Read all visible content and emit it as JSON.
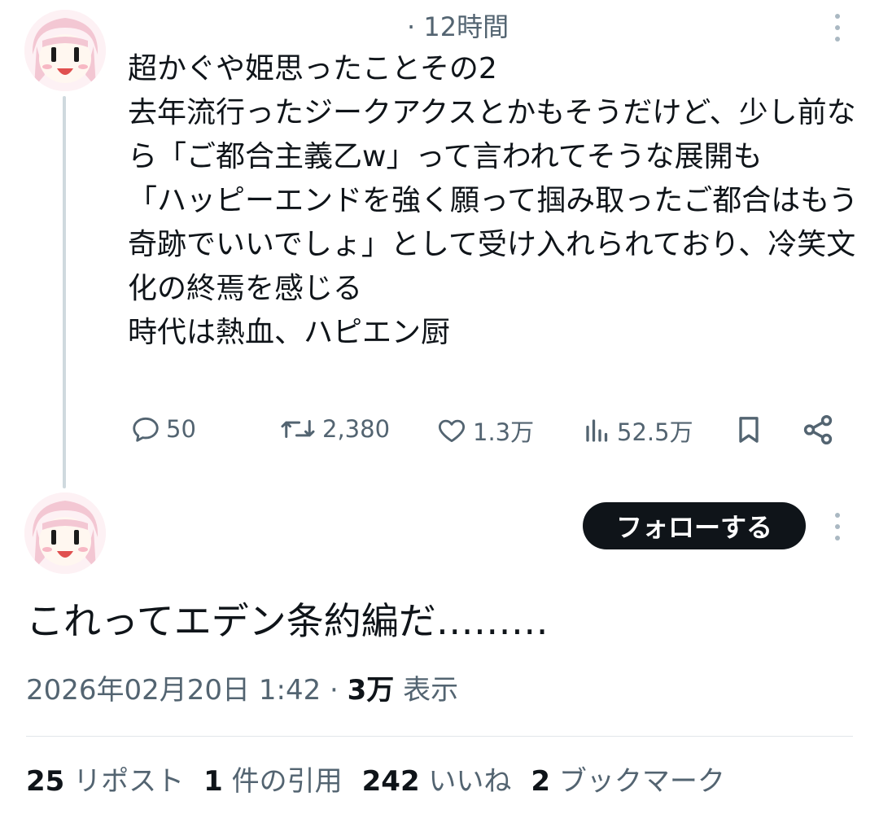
{
  "tweet": {
    "time": "· 12時間",
    "text": "超かぐや姫思ったことその2\n去年流行ったジークアクスとかもそうだけど、少し前なら「ご都合主義乙w」って言われてそうな展開も\n「ハッピーエンドを強く願って掴み取ったご都合はもう奇跡でいいでしょ」として受け入れられており、冷笑文化の終焉を感じる\n時代は熱血、ハピエン厨",
    "actions": {
      "replies": "50",
      "retweets": "2,380",
      "likes": "1.3万",
      "views": "52.5万"
    }
  },
  "reply": {
    "follow_label": "フォローする",
    "text": "これってエデン条約編だ………",
    "timestamp": "2026年02月20日 1:42 · ",
    "views_count": "3万",
    "views_label": " 表示"
  },
  "stats": [
    {
      "count": "25",
      "label": "リポスト"
    },
    {
      "count": "1",
      "label": "件の引用"
    },
    {
      "count": "242",
      "label": "いいね"
    },
    {
      "count": "2",
      "label": "ブックマーク"
    }
  ],
  "colors": {
    "text": "#0f1419",
    "muted": "#536471",
    "thread_line": "#cfd9de",
    "follow_bg": "#0f1419"
  }
}
